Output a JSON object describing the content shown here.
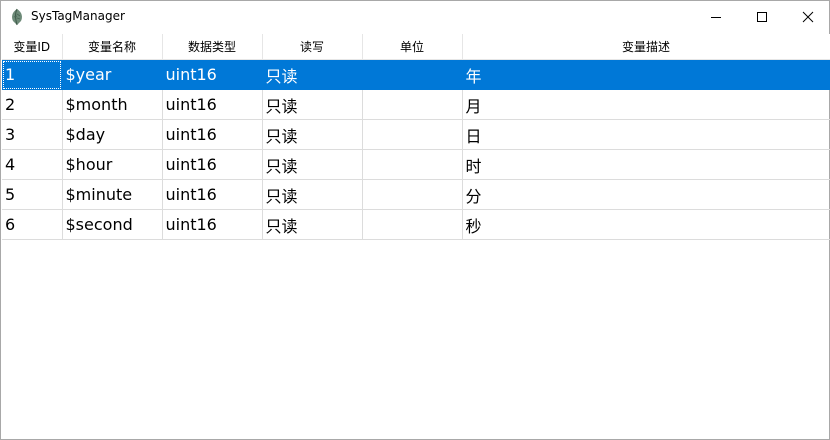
{
  "window": {
    "title": "SysTagManager",
    "icon": "app-leaf-icon",
    "controls": {
      "minimize": "minimize-icon",
      "maximize": "maximize-icon",
      "close": "close-icon"
    }
  },
  "table": {
    "columns": [
      "变量ID",
      "变量名称",
      "数据类型",
      "读写",
      "单位",
      "变量描述"
    ],
    "selected_row": 0,
    "rows": [
      [
        "1",
        "$year",
        "uint16",
        "只读",
        "",
        "年"
      ],
      [
        "2",
        "$month",
        "uint16",
        "只读",
        "",
        "月"
      ],
      [
        "3",
        "$day",
        "uint16",
        "只读",
        "",
        "日"
      ],
      [
        "4",
        "$hour",
        "uint16",
        "只读",
        "",
        "时"
      ],
      [
        "5",
        "$minute",
        "uint16",
        "只读",
        "",
        "分"
      ],
      [
        "6",
        "$second",
        "uint16",
        "只读",
        "",
        "秒"
      ]
    ]
  },
  "colors": {
    "selection": "#0078d7",
    "grid_line": "#dcdcdc"
  }
}
